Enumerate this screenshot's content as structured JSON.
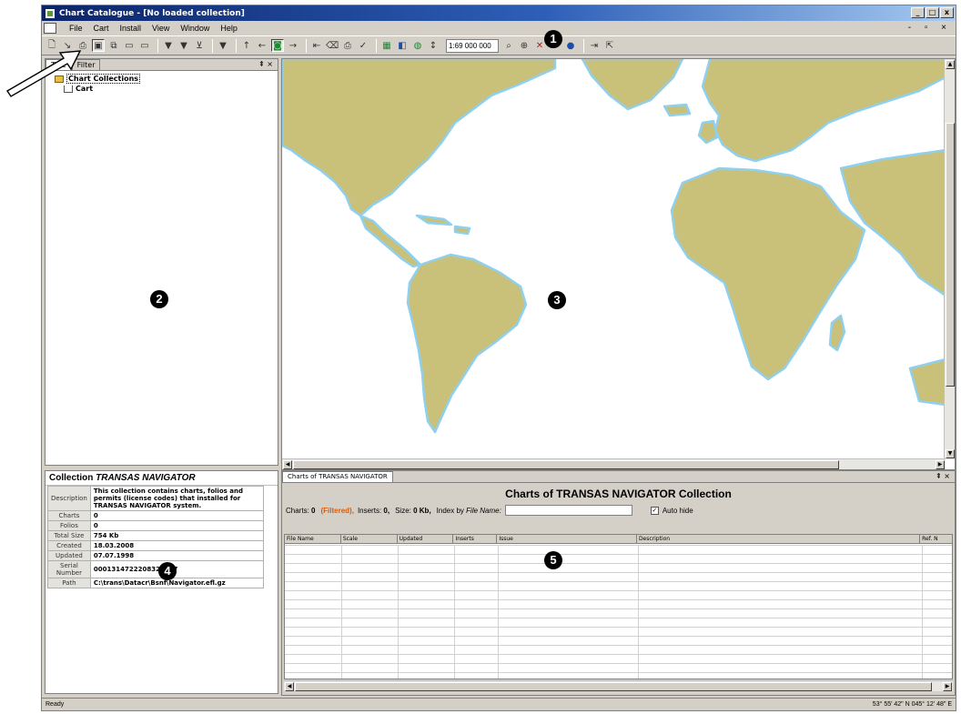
{
  "window": {
    "title": "Chart Catalogue - [No loaded collection]",
    "controls": [
      "_",
      "□",
      "x"
    ],
    "mdi_controls": "- ▫ ×"
  },
  "menu": [
    "File",
    "Cart",
    "Install",
    "View",
    "Window",
    "Help"
  ],
  "toolbar": {
    "scale_value": "1:69 000 000"
  },
  "callouts": [
    "1",
    "2",
    "3",
    "4",
    "5"
  ],
  "left_panel": {
    "tabs": [
      "Tree",
      "Filter"
    ],
    "pin": "⇞ ×",
    "tree": [
      {
        "label": "Chart Collections",
        "icon": "folder-icon"
      },
      {
        "label": "Cart",
        "icon": "cart-icon"
      }
    ]
  },
  "map": {
    "land_color": "#c9c07a",
    "shelf_color": "#8fd0ee",
    "sea_color": "#ffffff"
  },
  "collection": {
    "title_prefix": "Collection",
    "name": "TRANSAS NAVIGATOR",
    "rows": [
      {
        "key": "Description",
        "value": "This collection contains charts, folios and permits (license codes) that installed for TRANSAS NAVIGATOR system."
      },
      {
        "key": "Charts",
        "value": "0"
      },
      {
        "key": "Folios",
        "value": "0"
      },
      {
        "key": "Total Size",
        "value": "754 Kb"
      },
      {
        "key": "Created",
        "value": "18.03.2008"
      },
      {
        "key": "Updated",
        "value": "07.07.1998"
      },
      {
        "key": "Serial Number",
        "value": "0001314722208321787"
      },
      {
        "key": "Path",
        "value": "C:\\trans\\Datacr\\Bsnf\\Navigator.efl.gz"
      }
    ]
  },
  "charts_panel": {
    "tab": "Charts of TRANSAS NAVIGATOR",
    "pin": "⇞ ×",
    "header": "Charts of TRANSAS NAVIGATOR Collection",
    "stats": {
      "charts_label": "Charts:",
      "charts_value": "0",
      "filtered": "(Filtered),",
      "inserts_label": "Inserts:",
      "inserts_value": "0,",
      "size_label": "Size:",
      "size_value": "0 Kb,",
      "index_label": "Index by",
      "index_field": "File Name:",
      "autohide_label": "Auto hide",
      "autohide_checked": true
    },
    "columns": [
      "File Name",
      "Scale",
      "Updated",
      "Inserts",
      "Issue",
      "Description",
      "Ref. N"
    ]
  },
  "status": {
    "left": "Ready",
    "right": "53° 55' 42\" N  045° 12' 48\" E"
  }
}
